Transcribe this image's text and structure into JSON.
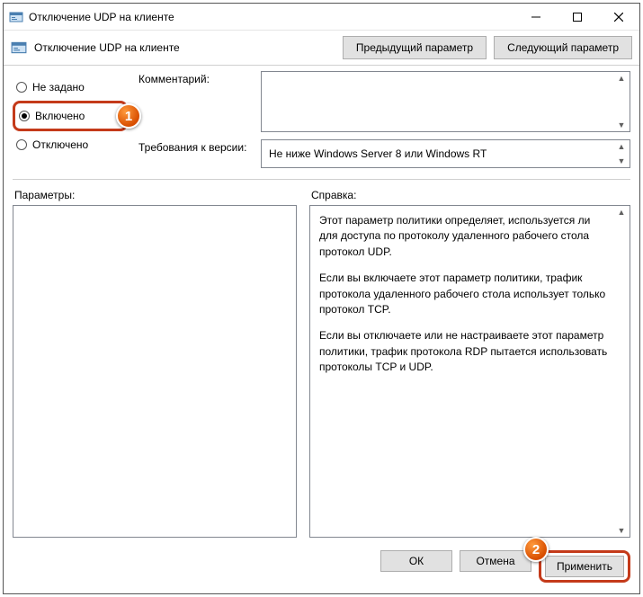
{
  "window": {
    "title": "Отключение UDP на клиенте"
  },
  "toolbar": {
    "title": "Отключение UDP на клиенте",
    "prev": "Предыдущий параметр",
    "next": "Следующий параметр"
  },
  "radios": {
    "not_configured": "Не задано",
    "enabled": "Включено",
    "disabled": "Отключено"
  },
  "labels": {
    "comment": "Комментарий:",
    "requirements": "Требования к версии:",
    "options": "Параметры:",
    "help": "Справка:"
  },
  "fields": {
    "comment": "",
    "requirements": "Не ниже Windows Server 8 или Windows RT"
  },
  "help": {
    "p1": "Этот параметр политики определяет, используется ли для доступа по протоколу удаленного рабочего стола протокол UDP.",
    "p2": "Если вы включаете этот параметр политики, трафик протокола удаленного рабочего стола использует только протокол TCP.",
    "p3": "Если вы отключаете или не настраиваете этот параметр политики, трафик протокола RDP пытается использовать протоколы TCP и UDP."
  },
  "buttons": {
    "ok": "ОК",
    "cancel": "Отмена",
    "apply": "Применить"
  },
  "badges": {
    "one": "1",
    "two": "2"
  }
}
